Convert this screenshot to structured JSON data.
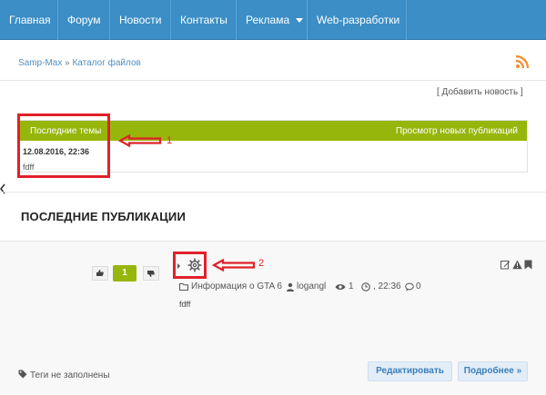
{
  "nav": {
    "items": [
      {
        "label": "Главная"
      },
      {
        "label": "Форум"
      },
      {
        "label": "Новости"
      },
      {
        "label": "Контакты"
      },
      {
        "label": "Реклама"
      },
      {
        "label": "Web-разработки"
      }
    ],
    "color": "#3b8ec6"
  },
  "breadcrumb": {
    "home": "Samp-Max",
    "separator": "»",
    "current": "Каталог файлов"
  },
  "rss_icon": "rss-icon",
  "add_news": "[ Добавить новость ]",
  "topics": {
    "title": "Последние темы",
    "view_new": "Просмотр новых публикаций",
    "date": "12.08.2016, 22:36",
    "text": "fdff",
    "accent": "#97b60b"
  },
  "section_title": "ПОСЛЕДНИЕ ПУБЛИКАЦИИ",
  "publication": {
    "rating": "1",
    "category": "Информация о GTA 6",
    "author": "logangl",
    "views": "1",
    "time": ", 22:36",
    "comments": "0",
    "text": "fdff",
    "tags": "Теги не заполнены",
    "edit_label": "Редактировать",
    "more_label": "Подробнее »"
  },
  "annotations": {
    "one": "1",
    "two": "2",
    "color": "#e0212a"
  }
}
